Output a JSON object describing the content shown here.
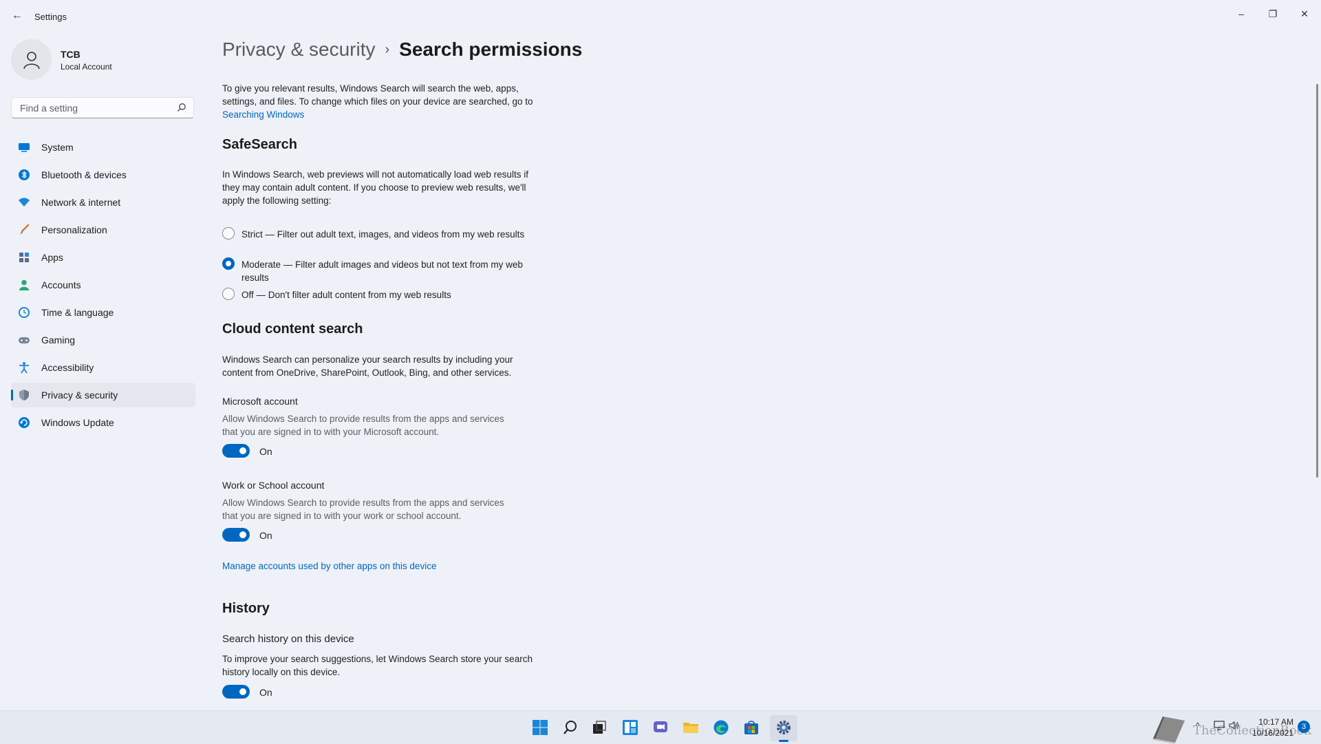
{
  "window": {
    "title": "Settings",
    "back_glyph": "←",
    "min_glyph": "–",
    "max_glyph": "❐",
    "close_glyph": "✕"
  },
  "profile": {
    "name": "TCB",
    "account_type": "Local Account"
  },
  "search": {
    "placeholder": "Find a setting",
    "value": ""
  },
  "sidebar": {
    "items": [
      {
        "label": "System",
        "icon": "monitor-icon",
        "active": false
      },
      {
        "label": "Bluetooth & devices",
        "icon": "bluetooth-icon",
        "active": false
      },
      {
        "label": "Network & internet",
        "icon": "wifi-icon",
        "active": false
      },
      {
        "label": "Personalization",
        "icon": "brush-icon",
        "active": false
      },
      {
        "label": "Apps",
        "icon": "apps-icon",
        "active": false
      },
      {
        "label": "Accounts",
        "icon": "person-icon",
        "active": false
      },
      {
        "label": "Time & language",
        "icon": "globe-clock-icon",
        "active": false
      },
      {
        "label": "Gaming",
        "icon": "gamepad-icon",
        "active": false
      },
      {
        "label": "Accessibility",
        "icon": "accessibility-icon",
        "active": false
      },
      {
        "label": "Privacy & security",
        "icon": "shield-icon",
        "active": true
      },
      {
        "label": "Windows Update",
        "icon": "update-icon",
        "active": false
      }
    ]
  },
  "breadcrumb": {
    "parent": "Privacy & security",
    "separator": "›",
    "current": "Search permissions"
  },
  "intro": {
    "text": "To give you relevant results, Windows Search will search the web, apps, settings, and files. To change which files on your device are searched, go to ",
    "link": "Searching Windows"
  },
  "safesearch": {
    "heading": "SafeSearch",
    "description": "In Windows Search, web previews will not automatically load web results if they may contain adult content. If you choose to preview web results, we'll apply the following setting:",
    "options": [
      {
        "label": "Strict — Filter out adult text, images, and videos from my web results",
        "selected": false
      },
      {
        "label": "Moderate — Filter adult images and videos but not text from my web results",
        "selected": true
      },
      {
        "label": "Off — Don't filter adult content from my web results",
        "selected": false
      }
    ]
  },
  "cloud": {
    "heading": "Cloud content search",
    "description": "Windows Search can personalize your search results by including your content from OneDrive, SharePoint, Outlook, Bing, and other services.",
    "microsoft": {
      "label": "Microsoft account",
      "description": "Allow Windows Search to provide results from the apps and services that you are signed in to with your Microsoft account.",
      "state": "On"
    },
    "work": {
      "label": "Work or School account",
      "description": "Allow Windows Search to provide results from the apps and services that you are signed in to with your work or school account.",
      "state": "On"
    },
    "manage_link": "Manage accounts used by other apps on this device"
  },
  "history": {
    "heading": "History",
    "label": "Search history on this device",
    "description": "To improve your search suggestions, let Windows Search store your search history locally on this device.",
    "state": "On"
  },
  "taskbar": {
    "apps": [
      "start-icon",
      "search-icon",
      "task-view-icon",
      "widgets-icon",
      "chat-icon",
      "file-explorer-icon",
      "edge-icon",
      "store-icon",
      "settings-icon"
    ],
    "tray_chevron": "^",
    "time": "10:17 AM",
    "date": "10/16/2021",
    "notification_count": "3",
    "watermark": "TheCollectionBook"
  },
  "colors": {
    "accent": "#0067c0",
    "background": "#eef1f7"
  }
}
